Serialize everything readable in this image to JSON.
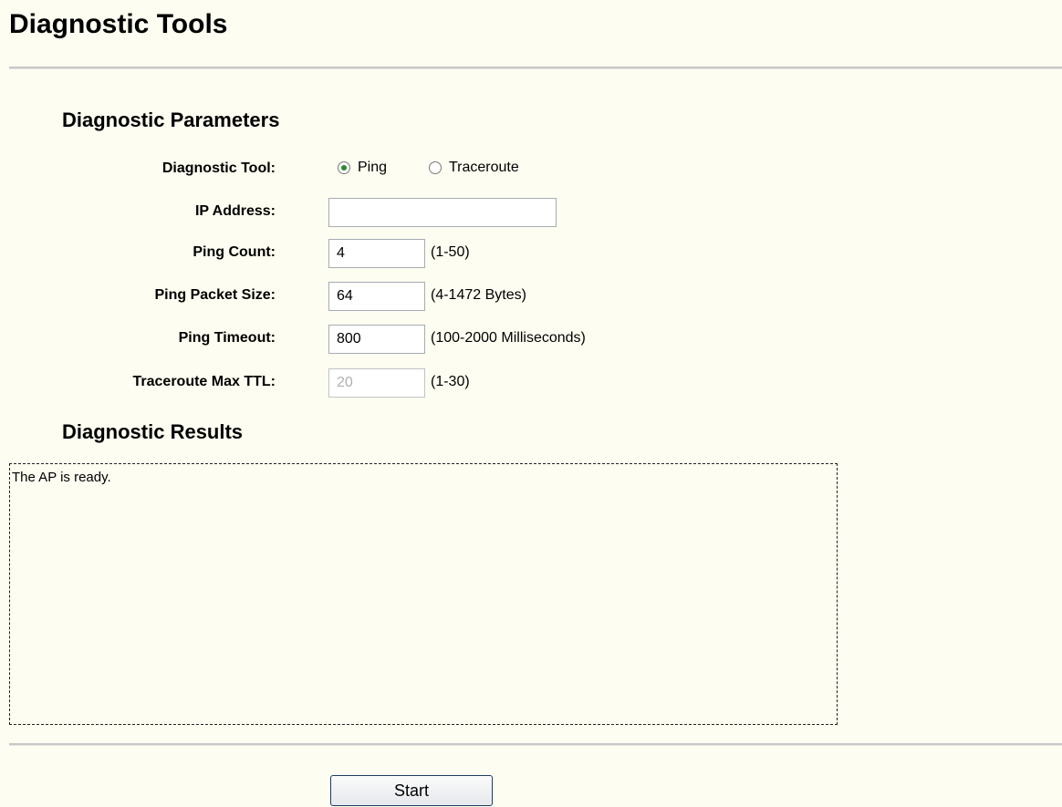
{
  "page": {
    "title": "Diagnostic Tools"
  },
  "parameters": {
    "title": "Diagnostic Parameters",
    "tool": {
      "label": "Diagnostic Tool:",
      "options": [
        {
          "label": "Ping",
          "selected": true
        },
        {
          "label": "Traceroute",
          "selected": false
        }
      ]
    },
    "ip_address": {
      "label": "IP Address:",
      "value": ""
    },
    "ping_count": {
      "label": "Ping Count:",
      "value": "4",
      "hint": "(1-50)"
    },
    "ping_packet_size": {
      "label": "Ping Packet Size:",
      "value": "64",
      "hint": "(4-1472 Bytes)"
    },
    "ping_timeout": {
      "label": "Ping Timeout:",
      "value": "800",
      "hint": "(100-2000 Milliseconds)"
    },
    "traceroute_max_ttl": {
      "label": "Traceroute Max TTL:",
      "value": "20",
      "hint": "(1-30)",
      "disabled": true
    }
  },
  "results": {
    "title": "Diagnostic Results",
    "text": "The AP is ready."
  },
  "actions": {
    "start_label": "Start"
  },
  "colors": {
    "background": "#fdfdf1",
    "radio_selected": "#2a8a2a",
    "button_border": "#1f3c66"
  }
}
